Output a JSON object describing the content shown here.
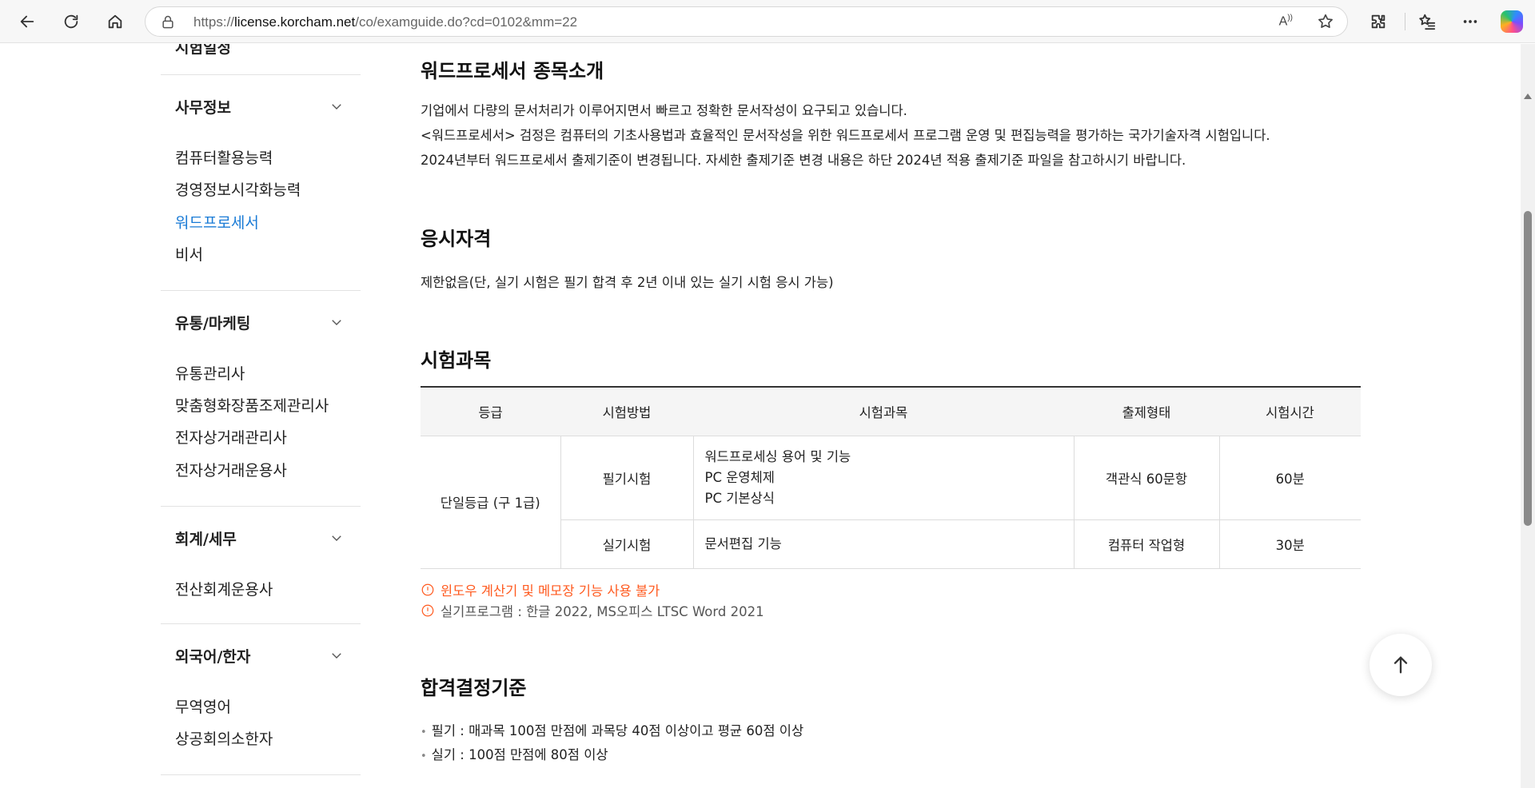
{
  "browser": {
    "url_prefix": "https://",
    "url_host": "license.korcham.net",
    "url_path": "/co/examguide.do?cd=0102&mm=22",
    "read_aloud_label": "A̅"
  },
  "sidebar": {
    "top_partial": "시험일정",
    "groups": [
      {
        "title": "사무정보",
        "items": [
          "컴퓨터활용능력",
          "경영정보시각화능력",
          "워드프로세서",
          "비서"
        ],
        "active_index": 2
      },
      {
        "title": "유통/마케팅",
        "items": [
          "유통관리사",
          "맞춤형화장품조제관리사",
          "전자상거래관리사",
          "전자상거래운용사"
        ]
      },
      {
        "title": "회계/세무",
        "items": [
          "전산회계운용사"
        ]
      },
      {
        "title": "외국어/한자",
        "items": [
          "무역영어",
          "상공회의소한자"
        ]
      }
    ]
  },
  "intro": {
    "title": "워드프로세서 종목소개",
    "lines": [
      "기업에서 다량의 문서처리가 이루어지면서 빠르고 정확한 문서작성이 요구되고 있습니다.",
      "<워드프로세서> 검정은 컴퓨터의 기초사용법과 효율적인 문서작성을 위한 워드프로세서 프로그램 운영 및 편집능력을 평가하는 국가기술자격 시험입니다.",
      "2024년부터 워드프로세서 출제기준이 변경됩니다. 자세한 출제기준 변경 내용은 하단 2024년 적용 출제기준 파일을 참고하시기 바랍니다."
    ]
  },
  "eligibility": {
    "title": "응시자격",
    "text": "제한없음(단, 실기 시험은 필기 합격 후 2년 이내 있는 실기 시험 응시 가능)"
  },
  "subjects": {
    "title": "시험과목",
    "headers": [
      "등급",
      "시험방법",
      "시험과목",
      "출제형태",
      "시험시간"
    ],
    "grade": "단일등급 (구 1급)",
    "rows": [
      {
        "method": "필기시험",
        "subjects": [
          "워드프로세싱 용어 및 기능",
          "PC 운영체제",
          "PC 기본상식"
        ],
        "format": "객관식 60문항",
        "time": "60분"
      },
      {
        "method": "실기시험",
        "subjects": [
          "문서편집 기능"
        ],
        "format": "컴퓨터 작업형",
        "time": "30분"
      }
    ],
    "notes": [
      "윈도우 계산기 및 메모장 기능 사용 불가",
      "실기프로그램 : 한글 2022, MS오피스 LTSC Word 2021"
    ]
  },
  "pass": {
    "title": "합격결정기준",
    "items": [
      "필기 : 매과목 100점 만점에 과목당 40점 이상이고 평균 60점 이상",
      "실기 : 100점 만점에 80점 이상"
    ]
  },
  "colors": {
    "active_link": "#1a7bd6",
    "warning": "#ff5a1f"
  },
  "icons": [
    "back-icon",
    "refresh-icon",
    "home-icon",
    "lock-icon",
    "read-aloud-icon",
    "star-icon",
    "extensions-icon",
    "favorites-icon",
    "more-icon",
    "copilot-icon",
    "chevron-down-icon",
    "info-circle-icon",
    "arrow-up-icon"
  ]
}
